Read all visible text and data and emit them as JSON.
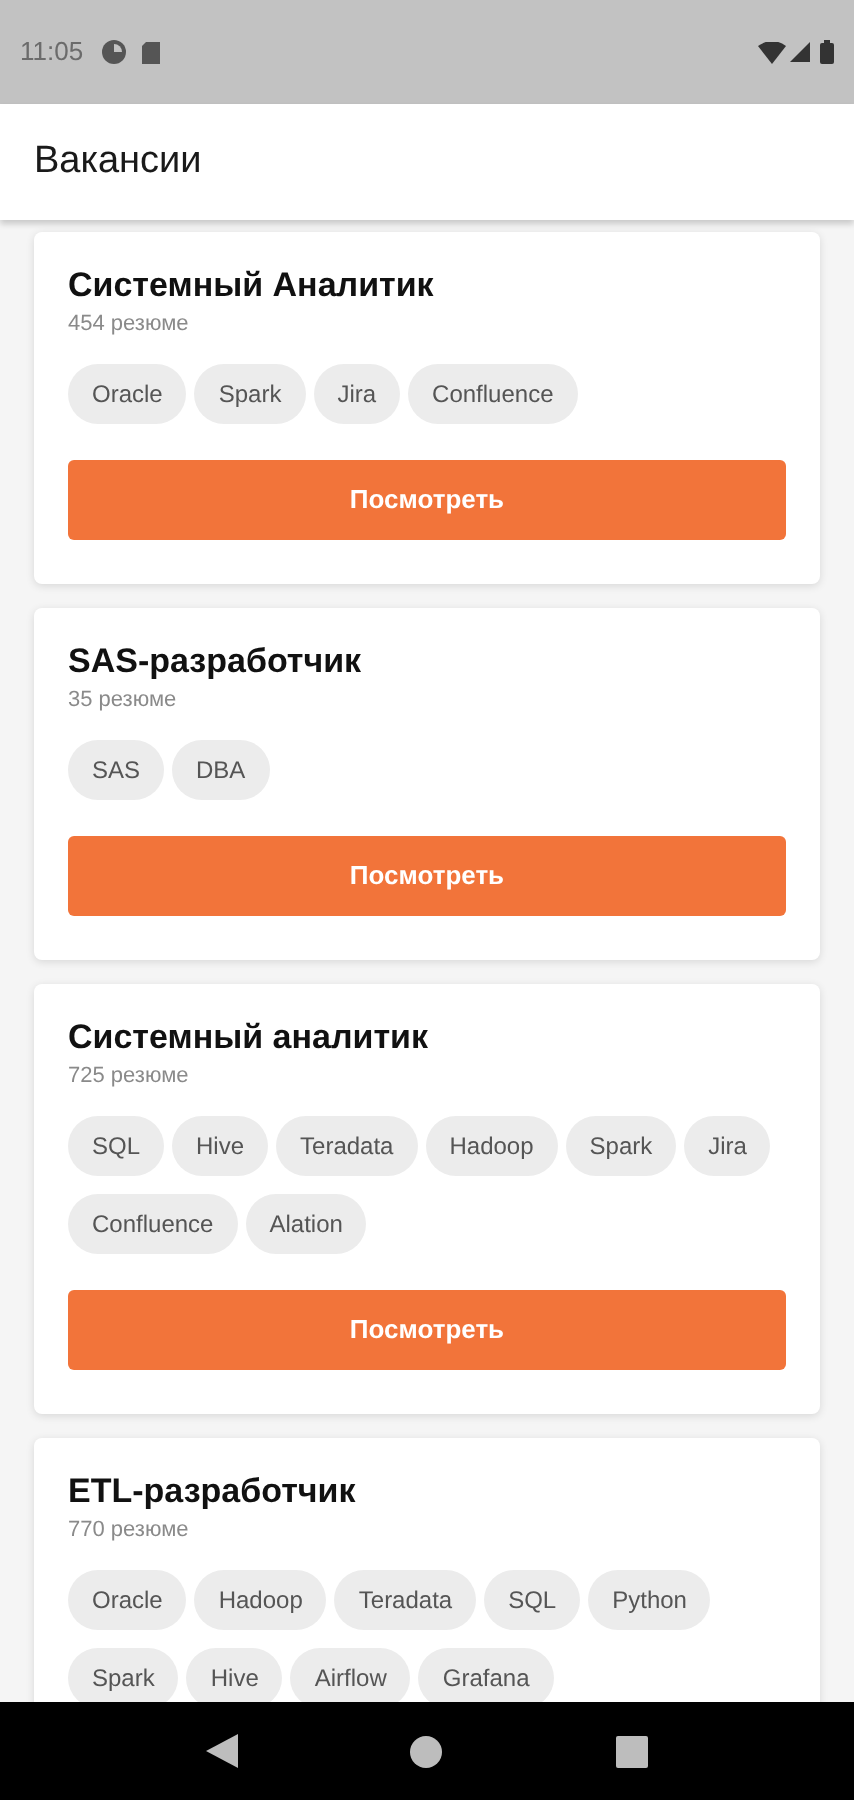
{
  "status_bar": {
    "time": "11:05"
  },
  "app_bar": {
    "title": "Вакансии"
  },
  "vacancies": [
    {
      "title": "Системный Аналитик",
      "resumes": "454 резюме",
      "skills": [
        "Oracle",
        "Spark",
        "Jira",
        "Confluence"
      ],
      "button": "Посмотреть"
    },
    {
      "title": "SAS-разработчик",
      "resumes": "35 резюме",
      "skills": [
        "SAS",
        "DBA"
      ],
      "button": "Посмотреть"
    },
    {
      "title": "Системный аналитик",
      "resumes": "725 резюме",
      "skills": [
        "SQL",
        "Hive",
        "Teradata",
        "Hadoop",
        "Spark",
        "Jira",
        "Confluence",
        "Alation"
      ],
      "button": "Посмотреть"
    },
    {
      "title": "ETL-разработчик",
      "resumes": "770 резюме",
      "skills": [
        "Oracle",
        "Hadoop",
        "Teradata",
        "SQL",
        "Python",
        "Spark",
        "Hive",
        "Airflow",
        "Grafana"
      ]
    }
  ]
}
